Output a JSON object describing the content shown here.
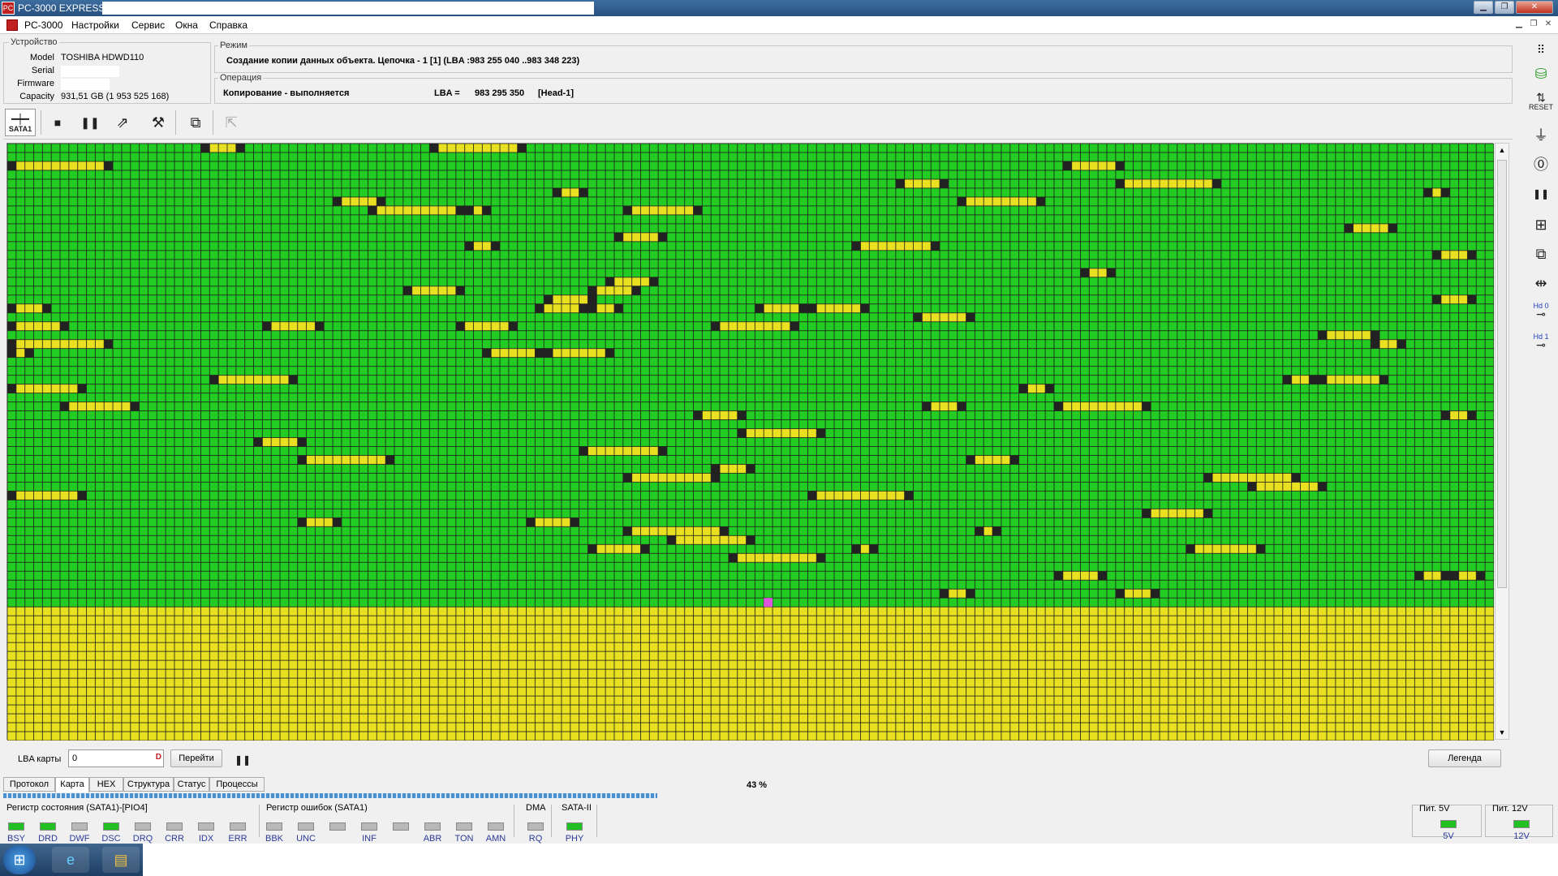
{
  "window": {
    "title": "PC-3000 EXPRESS -",
    "minimize": "▁",
    "restore": "❐",
    "close": "✕"
  },
  "menu": [
    "PC-3000",
    "Настройки",
    "Сервис",
    "Окна",
    "Справка"
  ],
  "device": {
    "legend": "Устройство",
    "model_label": "Model",
    "model": "TOSHIBA HDWD110",
    "serial_label": "Serial",
    "firmware_label": "Firmware",
    "capacity_label": "Capacity",
    "capacity": "931,51 GB (1 953 525 168)"
  },
  "mode": {
    "legend": "Режим",
    "text": "Создание копии данных объекта. Цепочка - 1 [1] (LBA :983 255 040 ..983 348 223)"
  },
  "operation": {
    "legend": "Операция",
    "status": "Копирование - выполняется",
    "lba_label": "LBA =",
    "lba": "983 295 350",
    "head": "[Head-1]"
  },
  "toolbar": {
    "port": "SATA1",
    "port_icon": "connector-icon"
  },
  "map": {
    "colors": {
      "good": "#22cc22",
      "pending": "#e8e020",
      "border": "#222222",
      "marker": "#dd55dd"
    },
    "columns": 169,
    "rows": 67
  },
  "controls": {
    "lba_label": "LBA карты",
    "lba_value": "0",
    "goto": "Перейти",
    "legend_button": "Легенда",
    "percent": "43 %",
    "progress": 0.43
  },
  "tabs": [
    "Протокол",
    "Карта",
    "HEX",
    "Структура",
    "Статус",
    "Процессы"
  ],
  "active_tab": "Карта",
  "status_register": {
    "title": "Регистр состояния (SATA1)-[PIO4]",
    "flags": [
      {
        "name": "BSY",
        "on": true
      },
      {
        "name": "DRD",
        "on": true
      },
      {
        "name": "DWF",
        "on": false
      },
      {
        "name": "DSC",
        "on": true
      },
      {
        "name": "DRQ",
        "on": false
      },
      {
        "name": "CRR",
        "on": false
      },
      {
        "name": "IDX",
        "on": false
      },
      {
        "name": "ERR",
        "on": false
      }
    ]
  },
  "error_register": {
    "title": "Регистр ошибок (SATA1)",
    "flags": [
      {
        "name": "BBK",
        "on": false
      },
      {
        "name": "UNC",
        "on": false
      },
      {
        "name": "",
        "on": false
      },
      {
        "name": "INF",
        "on": false
      },
      {
        "name": "",
        "on": false
      },
      {
        "name": "ABR",
        "on": false
      },
      {
        "name": "TON",
        "on": false
      },
      {
        "name": "AMN",
        "on": false
      }
    ]
  },
  "dma": {
    "title": "DMA",
    "flag": "RQ"
  },
  "sata": {
    "title": "SATA-II",
    "flag": "PHY"
  },
  "power5": {
    "title": "Пит. 5V",
    "flag": "5V"
  },
  "power12": {
    "title": "Пит. 12V",
    "flag": "12V"
  },
  "sidebar_labels": {
    "reset": "RESET",
    "hd0": "Hd 0",
    "hd1": "Hd 1"
  }
}
